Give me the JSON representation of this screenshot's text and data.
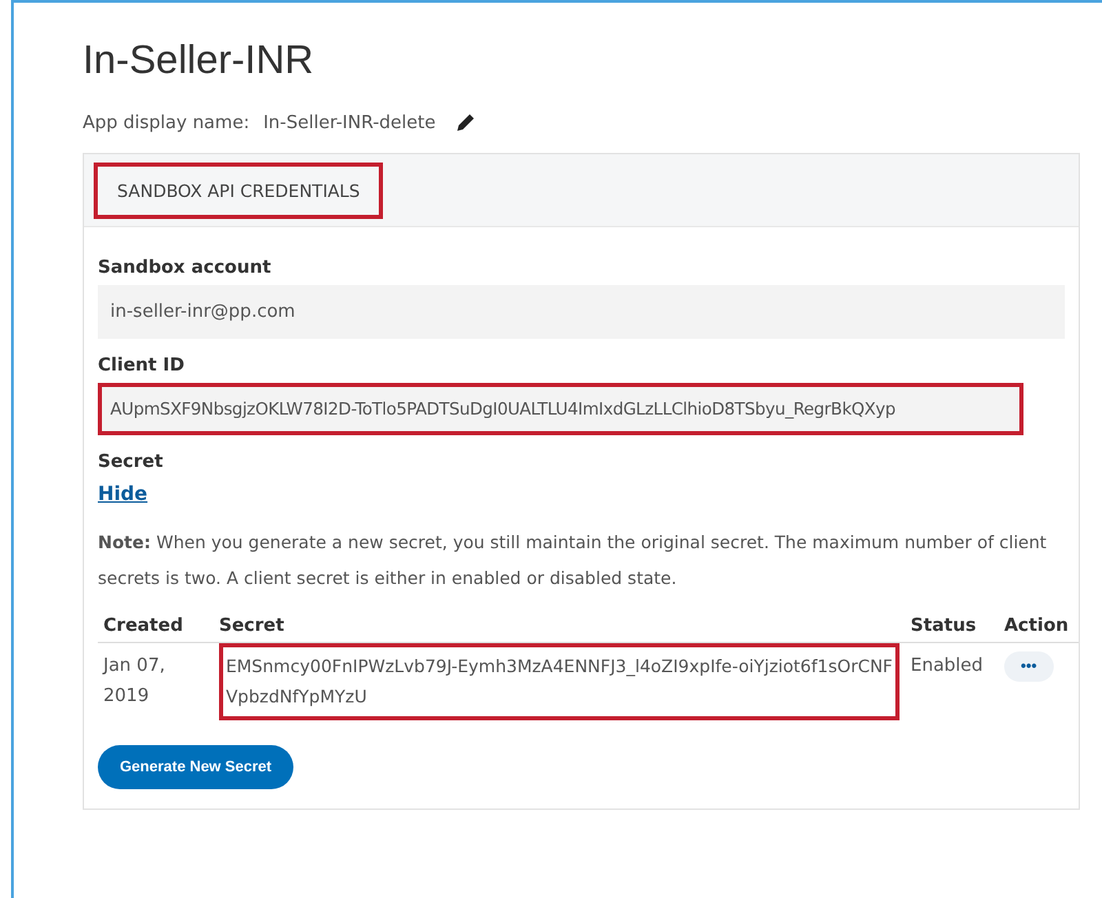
{
  "title": "In-Seller-INR",
  "display_name": {
    "label": "App display name:",
    "value": "In-Seller-INR-delete"
  },
  "panel": {
    "heading": "SANDBOX API CREDENTIALS",
    "highlighted": true
  },
  "sandbox_account": {
    "label": "Sandbox account",
    "value": "in-seller-inr@pp.com",
    "highlighted": false
  },
  "client_id": {
    "label": "Client ID",
    "value": "AUpmSXF9NbsgjzOKLW78I2D-ToTlo5PADTSuDgI0UALTLU4ImIxdGLzLLClhioD8TSbyu_RegrBkQXyp",
    "highlighted": true
  },
  "secret": {
    "label": "Secret",
    "toggle_link": "Hide"
  },
  "note": "**Note:** When you generate a new secret, you still maintain the original secret. The maximum number of client secrets is two. A client secret is either in enabled or disabled state.",
  "table": {
    "columns": [
      "Created",
      "Secret",
      "Status",
      "Action"
    ],
    "rows": [
      {
        "created": "Jan 07, 2019",
        "secret": "EMSnmcy00FnIPWzLvb79J-Eymh3MzA4ENNFJ3_l4oZI9xpIfe-oiYjziot6f1sOrCNFVpbzdNfYpMYzU",
        "status": "Enabled",
        "action": "•••",
        "highlighted": true
      }
    ]
  },
  "button": "Generate New Secret"
}
